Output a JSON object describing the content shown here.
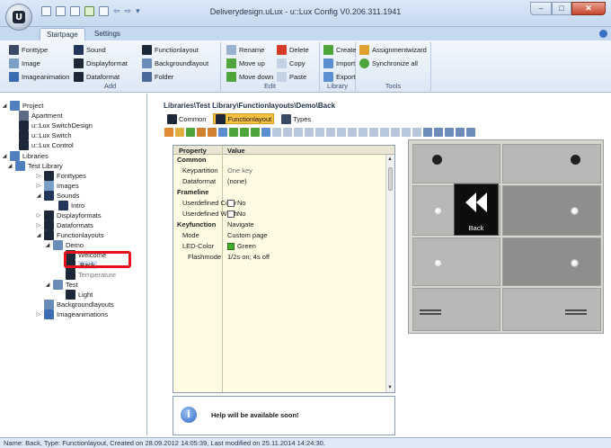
{
  "window": {
    "title": "Deliverydesign.uLux - u::Lux Config V0.206.311.1941",
    "controls": {
      "minimize": "–",
      "maximize": "□",
      "close": "✕"
    }
  },
  "tabs": [
    "Startpage",
    "Settings"
  ],
  "ribbon": {
    "add": {
      "label": "Add",
      "col1": [
        "Fonttype",
        "Image",
        "Imageanimation"
      ],
      "col2": [
        "Sound",
        "Displayformat",
        "Dataformat"
      ],
      "col3": [
        "Functionlayout",
        "Backgroundlayout",
        "Folder"
      ]
    },
    "edit": {
      "label": "Edit",
      "col1": [
        "Rename",
        "Move up",
        "Move down"
      ],
      "col2": [
        "Delete",
        "Copy",
        "Paste"
      ]
    },
    "library": {
      "label": "Library",
      "items": [
        "Create",
        "Import",
        "Export"
      ]
    },
    "tools": {
      "label": "Tools",
      "items": [
        "Assignmentwizard",
        "Synchronize all"
      ]
    }
  },
  "tree": {
    "project": "Project",
    "apartment": "Apartment",
    "switchdesign": "u::Lux SwitchDesign",
    "switch": "u::Lux Switch",
    "control": "u::Lux Control",
    "libraries": "Libraries",
    "testlibrary": "Test Library",
    "fonttypes": "Fonttypes",
    "images": "Images",
    "sounds": "Sounds",
    "intro": "Intro",
    "displayformats": "Displayformats",
    "dataformats": "Dataformats",
    "functionlayouts": "Functionlayouts",
    "demo": "Demo",
    "welcome": "Welcome",
    "back": "Back",
    "temperature": "Temperature",
    "test": "Test",
    "light": "Light",
    "backgroundlayouts": "Backgroundlayouts",
    "imageanimations": "Imageanimations"
  },
  "breadcrumb": "Libraries\\Test Library\\Functionlayouts\\Demo\\Back",
  "subtabs": [
    "Common",
    "Functionlayout",
    "Types"
  ],
  "propgrid": {
    "head": {
      "property": "Property",
      "value": "Value"
    },
    "common": "Common",
    "keypartition": {
      "name": "Keypartition",
      "value": "One key"
    },
    "dataformat": {
      "name": "Dataformat",
      "value": "(none)"
    },
    "frameline": "Frameline",
    "udcolor": {
      "name": "Userdefined Color",
      "value": "No"
    },
    "udwidth": {
      "name": "Userdefined Width",
      "value": "No"
    },
    "keyfunction": {
      "name": "Keyfunction",
      "value": "Navigate"
    },
    "mode": {
      "name": "Mode",
      "value": "Custom page"
    },
    "ledcolor": {
      "name": "LED-Color",
      "value": "Green"
    },
    "flashmode": {
      "name": "Flashmode",
      "value": "1/2s on; 4s off"
    }
  },
  "help": {
    "text": "Help will be available soon!",
    "icon": "i"
  },
  "preview": {
    "back_label": "Back"
  },
  "status": "Name: Back, Type: Functionlayout, Created on 28.09.2012 14:05:39, Last modified on 25.11.2014 14:24:30.",
  "colors": {
    "highlight": "#e8111b",
    "active_tab": "#f6c043",
    "ribbon_bg": "#dde8f5"
  }
}
